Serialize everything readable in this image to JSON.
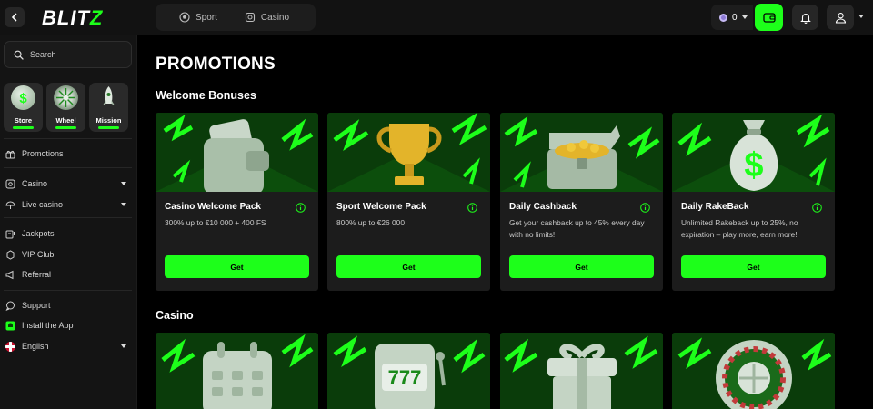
{
  "header": {
    "logo": "BLITZ",
    "tabs": [
      {
        "label": "Sport",
        "icon": "soccer-ball-icon"
      },
      {
        "label": "Casino",
        "icon": "casino-icon"
      }
    ],
    "balance": "0",
    "colors": {
      "accent": "#1dff1a",
      "bar": "#121212"
    }
  },
  "sidebar": {
    "search_placeholder": "Search",
    "tiles": [
      {
        "label": "Store",
        "icon": "dollar-coin-icon"
      },
      {
        "label": "Wheel",
        "icon": "wheel-icon"
      },
      {
        "label": "Mission",
        "icon": "rocket-icon"
      }
    ],
    "items": [
      {
        "label": "Promotions",
        "icon": "gift-icon"
      },
      {
        "label": "Casino",
        "icon": "casino-icon"
      },
      {
        "label": "Live casino",
        "icon": "live-casino-icon"
      },
      {
        "label": "Jackpots",
        "icon": "jackpot-icon"
      },
      {
        "label": "VIP Club",
        "icon": "vip-icon"
      },
      {
        "label": "Referral",
        "icon": "megaphone-icon"
      },
      {
        "label": "Support",
        "icon": "chat-icon"
      },
      {
        "label": "Install the App",
        "icon": "android-icon"
      },
      {
        "label": "English",
        "icon": "uk-flag-icon"
      }
    ]
  },
  "main": {
    "title": "PROMOTIONS",
    "sections": [
      {
        "title": "Welcome Bonuses"
      },
      {
        "title": "Casino"
      }
    ],
    "welcome_cards": [
      {
        "title": "Casino Welcome Pack",
        "description": "300% up to €10 000 + 400 FS",
        "button": "Get",
        "art": "wallet-icon"
      },
      {
        "title": "Sport Welcome Pack",
        "description": "800% up to €26 000",
        "button": "Get",
        "art": "trophy-icon"
      },
      {
        "title": "Daily Cashback",
        "description": "Get your cashback up to 45% every day with no limits!",
        "button": "Get",
        "art": "treasure-chest-icon"
      },
      {
        "title": "Daily RakeBack",
        "description": "Unlimited Rakeback up to 25%, no expiration – play more, earn more!",
        "button": "Get",
        "art": "money-bag-icon"
      }
    ],
    "casino_cards": [
      {
        "art": "calendar-icon"
      },
      {
        "art": "slot-machine-icon"
      },
      {
        "art": "gift-box-icon"
      },
      {
        "art": "roulette-icon"
      }
    ]
  }
}
